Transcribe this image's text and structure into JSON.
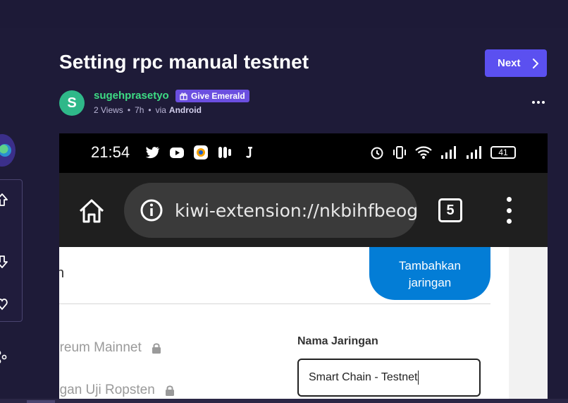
{
  "post": {
    "title": "Setting rpc manual testnet",
    "next_label": "Next",
    "author": "sugehprasetyo",
    "avatar_letter": "S",
    "give_emerald_label": "Give Emerald",
    "views": "2 Views",
    "age": "7h",
    "via_label": "via",
    "via_value": "Android"
  },
  "colors": {
    "background": "#1e1b38",
    "accent": "#5b50f0",
    "emerald": "#3ddc84",
    "emerald_button": "#6b4fe0",
    "metamask_blue": "#037dd6"
  },
  "icons": {
    "next": "chevron-right-icon",
    "emerald": "gift-icon",
    "more": "more-horizontal-icon",
    "rail": [
      "upvote-icon",
      "downvote-icon",
      "heart-icon",
      "share-icon"
    ]
  },
  "screenshot": {
    "status_bar": {
      "time": "21:54",
      "battery": "41"
    },
    "browser": {
      "url": "kiwi-extension://nkbihfbeog",
      "tab_count": "5"
    },
    "page": {
      "fragment_text": "n",
      "add_network_button": "Tambahkan jaringan",
      "networks": [
        "ereum Mainnet",
        "ngan Uji Ropsten"
      ],
      "field_label": "Nama Jaringan",
      "field_value": "Smart Chain - Testnet"
    }
  }
}
